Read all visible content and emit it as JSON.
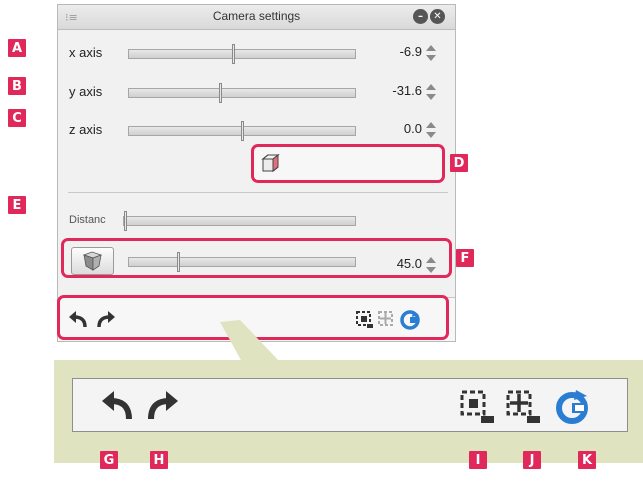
{
  "window": {
    "title": "Camera settings",
    "menu_glyph": "⁝≡",
    "minimize_glyph": "–",
    "close_glyph": "✕"
  },
  "axes": [
    {
      "label": "x axis",
      "value": "-6.9",
      "slider_fraction": 0.46
    },
    {
      "label": "y axis",
      "value": "-31.6",
      "slider_fraction": 0.41
    },
    {
      "label": "z axis",
      "value": "0.0",
      "slider_fraction": 0.5
    }
  ],
  "cube_presets": [
    "cube-view-1-icon",
    "cube-view-2-icon",
    "cube-view-3-icon",
    "cube-view-4-icon",
    "cube-view-5-icon",
    "cube-view-6-icon"
  ],
  "distance": {
    "label": "Distanc",
    "slider_fraction": 0.0
  },
  "field_of_view": {
    "value": "45.0",
    "slider_fraction": 0.22
  },
  "badges": {
    "a": "A",
    "b": "B",
    "c": "C",
    "d": "D",
    "e": "E",
    "f": "F",
    "g": "G",
    "h": "H",
    "i": "I",
    "j": "J",
    "k": "K"
  },
  "colors": {
    "accent": "#e0285a",
    "panel_bg": "#f1f1f1",
    "callout_bg": "#dfe3bf",
    "reset_blue": "#2a7dd3",
    "cube_red": "#e1707c"
  }
}
